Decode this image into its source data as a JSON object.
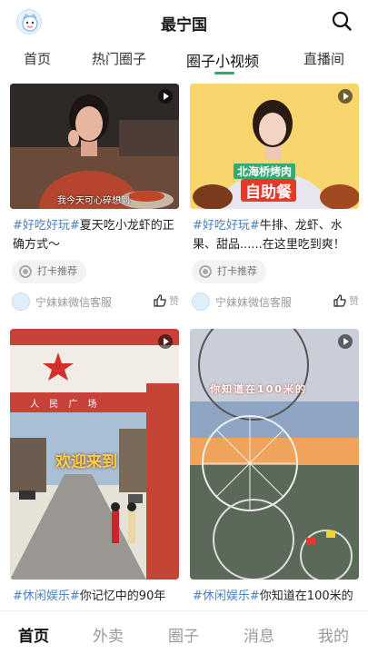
{
  "header": {
    "title": "最宁国"
  },
  "tabs": [
    {
      "label": "首页"
    },
    {
      "label": "热门圈子"
    },
    {
      "label": "圈子小视频",
      "active": true
    },
    {
      "label": "直播间"
    }
  ],
  "accent_color": "#20b26b",
  "tag_color": "#4a7fc1",
  "posts": [
    {
      "thumb_text": "我今天可心碎想到",
      "tag": "#好吃好玩#",
      "text": "夏天吃小龙虾的正确方式～",
      "checkin": "打卡推荐",
      "author": "宁妹妹微信客服",
      "like": "赞"
    },
    {
      "thumb_text_1": "北海桥烤肉",
      "thumb_text_2": "自助餐",
      "tag": "#好吃好玩#",
      "text": "牛排、龙虾、水果、甜品......在这里吃到爽！",
      "checkin": "打卡推荐",
      "author": "宁妹妹微信客服",
      "like": "赞"
    },
    {
      "sign_text": "人 民 广 场",
      "thumb_text": "欢迎来到",
      "tag": "#休闲娱乐#",
      "text": "你记忆中的90年"
    },
    {
      "thumb_text": "你知道在100米的",
      "tag": "#休闲娱乐#",
      "text": "你知道在100米的"
    }
  ],
  "bottom_nav": [
    {
      "label": "首页",
      "active": true
    },
    {
      "label": "外卖"
    },
    {
      "label": "圈子"
    },
    {
      "label": "消息"
    },
    {
      "label": "我的"
    }
  ]
}
